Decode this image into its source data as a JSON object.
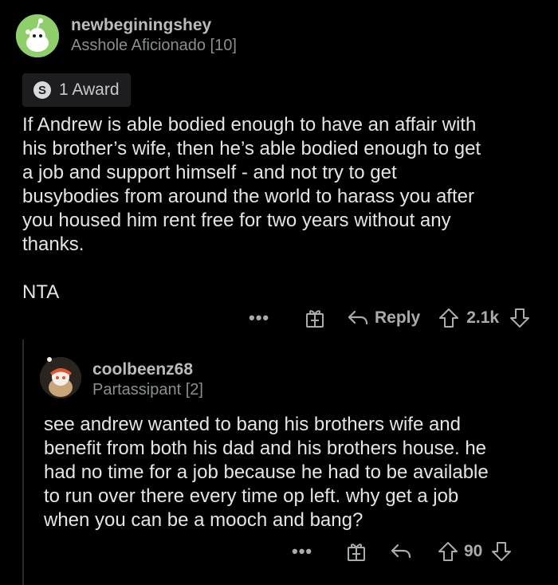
{
  "comments": [
    {
      "username": "newbeginingshey",
      "flair": "Asshole Aficionado [10]",
      "award_label": "1 Award",
      "body": "If Andrew is able bodied enough to have an affair with\nhis brother’s wife, then he’s able bodied enough to get\na job and support himself - and not try to get\nbusybodies from around the world to harass you after\nyou housed him rent free for two years without any\nthanks.\n\nNTA",
      "reply_label": "Reply",
      "score": "2.1k",
      "avatar_color": "#8fcf6b"
    },
    {
      "username": "coolbeenz68",
      "flair": "Partassipant [2]",
      "body": "see andrew wanted to bang his brothers wife and\nbenefit from both his dad and his brothers house. he\nhad no time for a job because he had to be available\nto run over there every time op left. why get a job\nwhen you can be a mooch and bang?",
      "score": "90",
      "avatar_color": "#c9a57a"
    }
  ],
  "icons": {
    "more": "more-dots-icon",
    "gift": "gift-award-icon",
    "reply": "reply-arrow-icon",
    "upvote": "upvote-icon",
    "downvote": "downvote-icon"
  }
}
